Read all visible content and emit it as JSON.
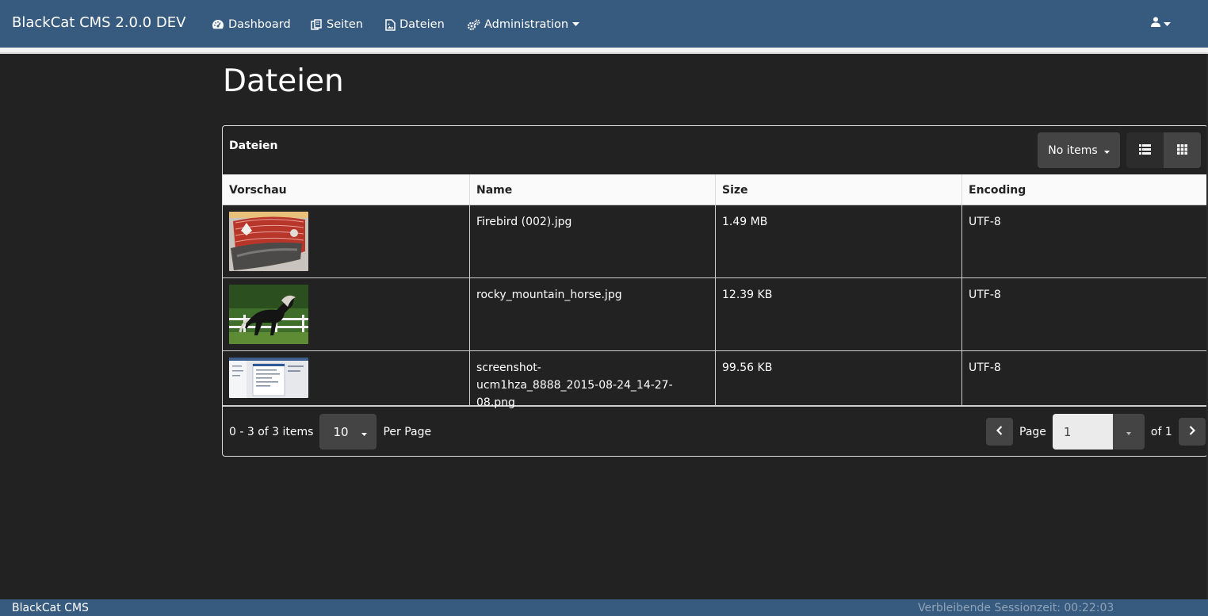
{
  "navbar": {
    "brand": "BlackCat CMS 2.0.0 DEV",
    "items": [
      {
        "label": "Dashboard",
        "icon": "dashboard-icon"
      },
      {
        "label": "Seiten",
        "icon": "pages-icon"
      },
      {
        "label": "Dateien",
        "icon": "file-image-icon"
      },
      {
        "label": "Administration",
        "icon": "cogs-icon"
      }
    ],
    "user_icon": "user-icon",
    "accent_color": "#375a7f"
  },
  "page": {
    "title": "Dateien"
  },
  "panel": {
    "title": "Dateien",
    "no_items_label": "No items",
    "view_list_icon": "list-icon",
    "view_grid_icon": "grid-icon"
  },
  "table": {
    "columns": [
      "Vorschau",
      "Name",
      "Size",
      "Encoding"
    ],
    "rows": [
      {
        "preview": "firebird-thumbnail",
        "name": "Firebird (002).jpg",
        "size": "1.49 MB",
        "encoding": "UTF-8"
      },
      {
        "preview": "horse-thumbnail",
        "name": "rocky_mountain_horse.jpg",
        "size": "12.39 KB",
        "encoding": "UTF-8"
      },
      {
        "preview": "screenshot-thumbnail",
        "name_line1": "screenshot-",
        "name_line2": "ucm1hza_8888_2015-08-24_14-27-08.png",
        "size": "99.56 KB",
        "encoding": "UTF-8"
      }
    ]
  },
  "pager": {
    "summary": "0 - 3 of 3 items",
    "per_page_value": "10",
    "per_page_label": "Per Page",
    "page_label": "Page",
    "page_value": "1",
    "of_label": "of 1"
  },
  "footer": {
    "brand": "BlackCat CMS",
    "session": "Verbleibende Sessionzeit: 00:22:03"
  }
}
